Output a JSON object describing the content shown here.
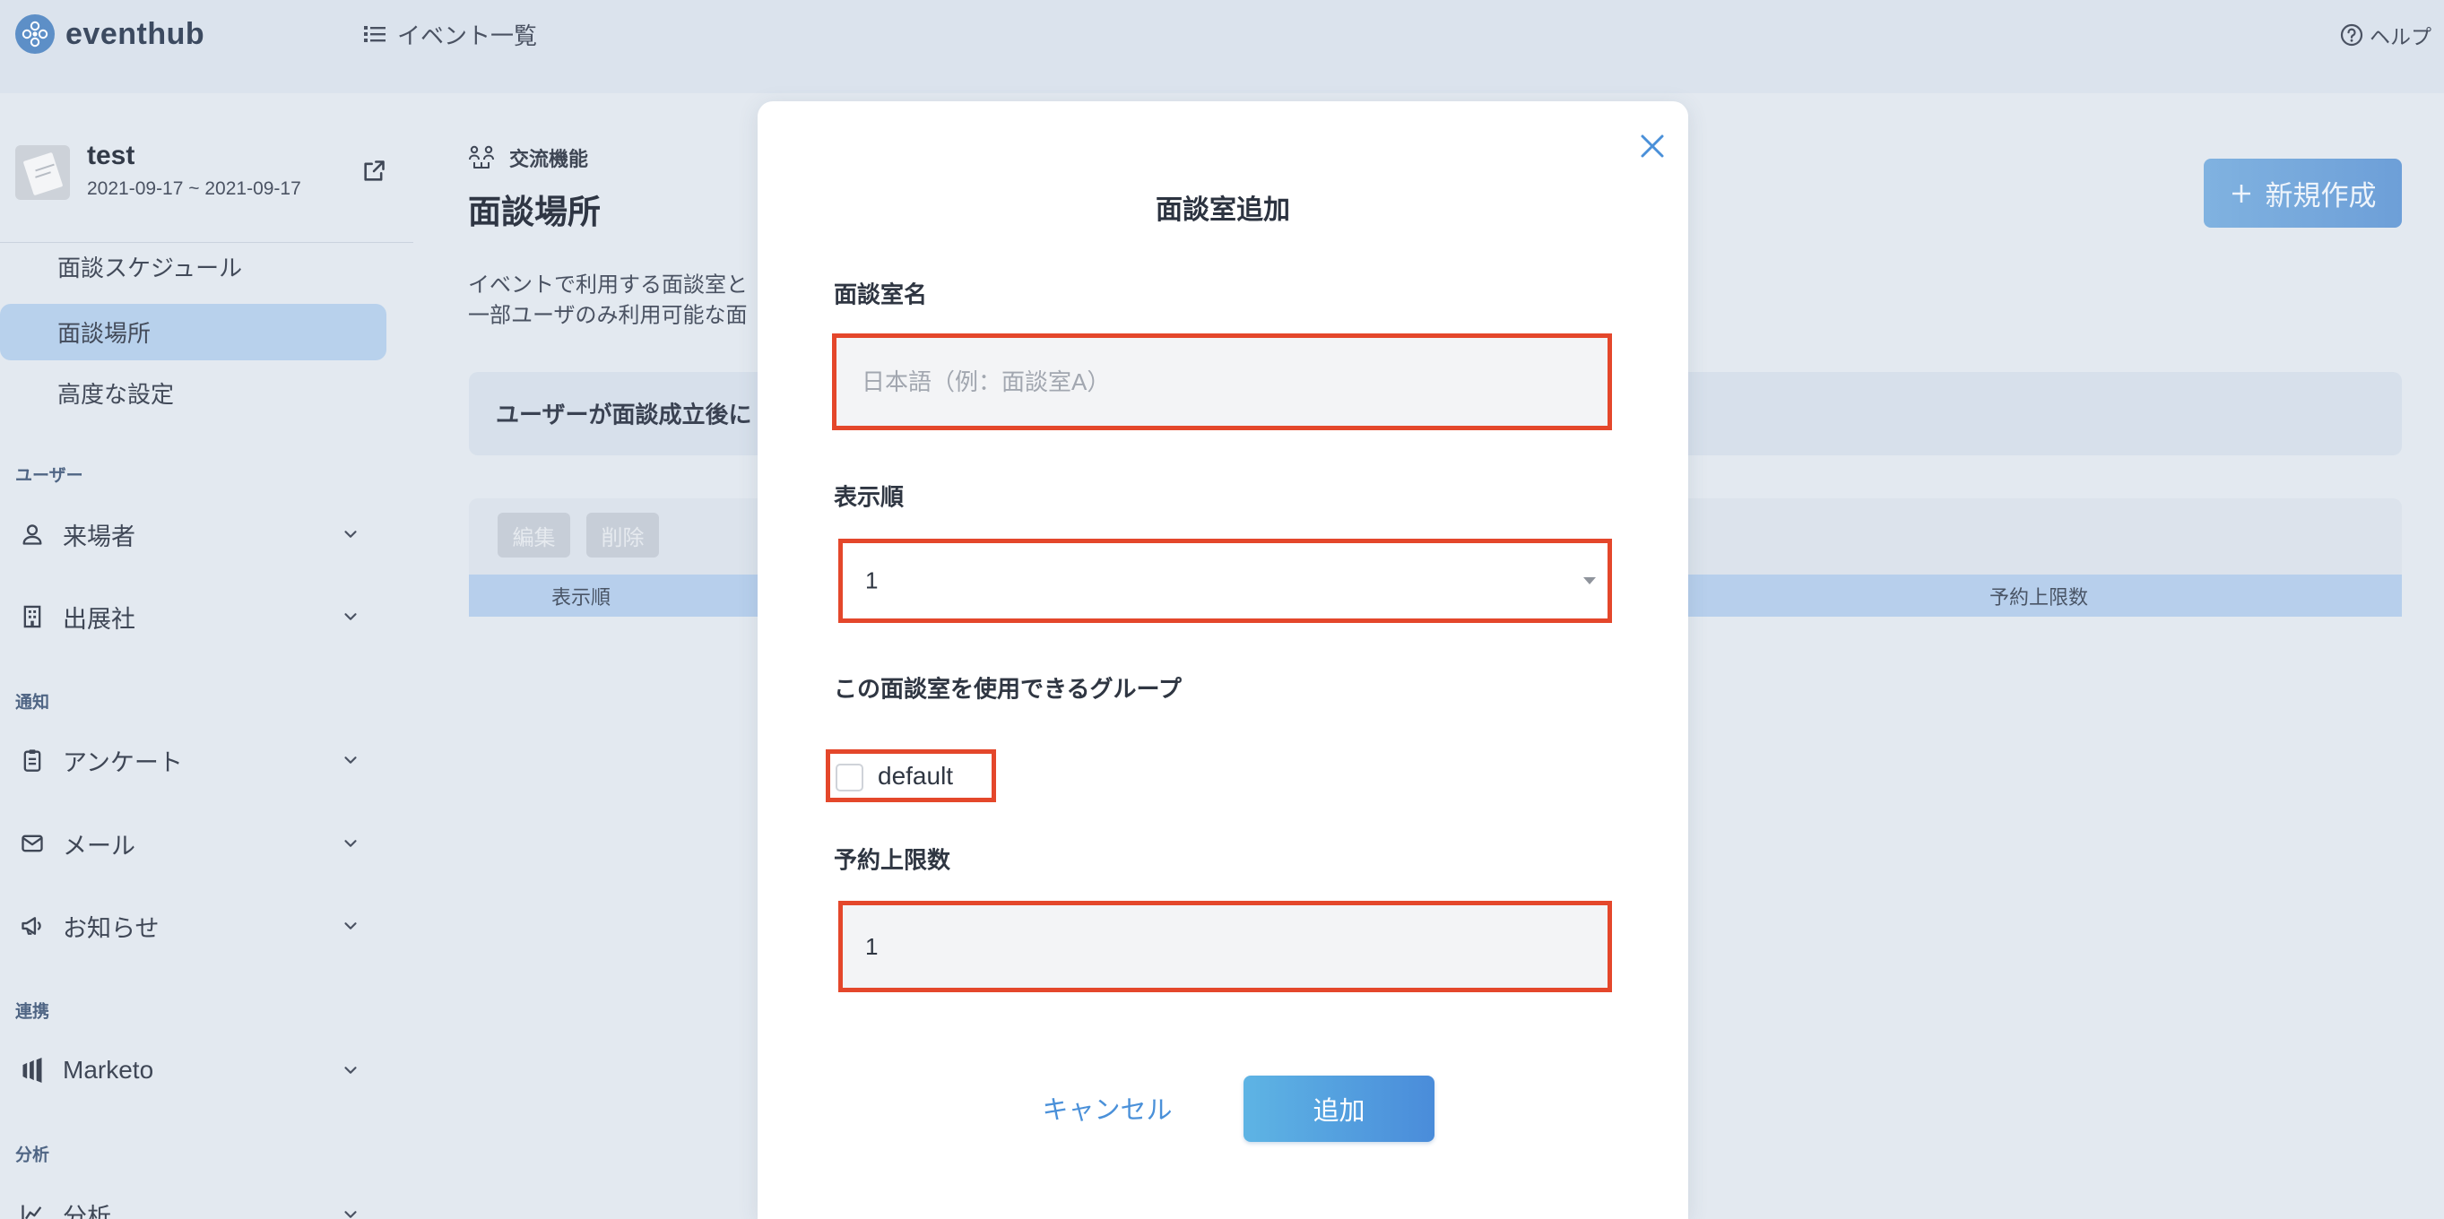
{
  "colors": {
    "accent": "#4a90d9",
    "highlight_border": "#e4472b",
    "active_menu_bg": "#b8d1ec",
    "primary_button": "#5a9fdf"
  },
  "header": {
    "logo_text": "eventhub",
    "logo_icon": "eventhub-logo-icon",
    "nav": {
      "icon": "list-icon",
      "label": "イベント一覧"
    },
    "help": {
      "icon": "question-circle-icon",
      "label": "ヘルプ"
    }
  },
  "sidebar": {
    "event": {
      "name": "test",
      "dates": "2021-09-17 ~ 2021-09-17",
      "link_icon": "external-link-icon"
    },
    "submenu": [
      {
        "label": "面談スケジュール",
        "active": false
      },
      {
        "label": "面談場所",
        "active": true
      },
      {
        "label": "高度な設定",
        "active": false
      }
    ],
    "sections": [
      {
        "title": "ユーザー",
        "items": [
          {
            "label": "来場者",
            "icon": "user-icon"
          },
          {
            "label": "出展社",
            "icon": "building-icon"
          }
        ]
      },
      {
        "title": "通知",
        "items": [
          {
            "label": "アンケート",
            "icon": "clipboard-icon"
          },
          {
            "label": "メール",
            "icon": "envelope-icon"
          },
          {
            "label": "お知らせ",
            "icon": "megaphone-icon"
          }
        ]
      },
      {
        "title": "連携",
        "items": [
          {
            "label": "Marketo",
            "icon": "marketo-icon"
          }
        ]
      },
      {
        "title": "分析",
        "items": [
          {
            "label": "分析",
            "icon": "chart-icon"
          }
        ]
      }
    ]
  },
  "main": {
    "breadcrumb": {
      "icon": "networking-icon",
      "label": "交流機能"
    },
    "title": "面談場所",
    "description": [
      "イベントで利用する面談室と",
      "一部ユーザのみ利用可能な面"
    ],
    "notice": "ユーザーが面談成立後に",
    "new_button": {
      "icon": "plus-icon",
      "label": "新規作成"
    },
    "table": {
      "edit_label": "編集",
      "delete_label": "削除",
      "columns": [
        "表示順",
        "予約上限数"
      ]
    }
  },
  "modal": {
    "title": "面談室追加",
    "close_icon": "close-icon",
    "name_field": {
      "label": "面談室名",
      "placeholder": "日本語（例：面談室A）"
    },
    "order_field": {
      "label": "表示順",
      "value": "1"
    },
    "groups_field": {
      "label": "この面談室を使用できるグループ",
      "options": [
        {
          "label": "default",
          "checked": false
        }
      ]
    },
    "limit_field": {
      "label": "予約上限数",
      "value": "1"
    },
    "cancel_label": "キャンセル",
    "submit_label": "追加"
  }
}
